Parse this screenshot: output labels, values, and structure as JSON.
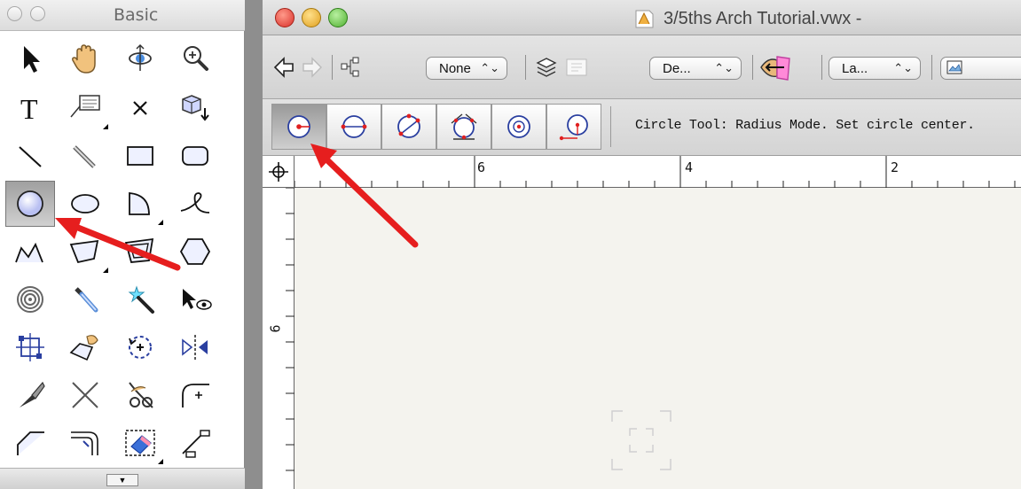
{
  "palette": {
    "title": "Basic",
    "selected_tool": "circle-tool",
    "tools": [
      [
        "selection-tool",
        "pan-tool",
        "flyover-tool",
        "zoom-tool"
      ],
      [
        "text-tool",
        "callout-tool",
        "locus-tool",
        "symbol-insertion-tool"
      ],
      [
        "line-tool",
        "double-line-tool",
        "rectangle-tool",
        "rounded-rectangle-tool"
      ],
      [
        "circle-tool",
        "oval-tool",
        "arc-tool",
        "freehand-tool"
      ],
      [
        "polyline-tool",
        "polygon-tool",
        "double-line-polygon-tool",
        "regular-polygon-tool"
      ],
      [
        "spiral-tool",
        "eyedropper-tool",
        "wand-tool",
        "visibility-tool"
      ],
      [
        "reshape-tool",
        "attribute-mapping-tool",
        "rotate-tool",
        "mirror-tool"
      ],
      [
        "split-tool",
        "trim-tool",
        "clip-tool",
        "fillet-tool"
      ],
      [
        "chamfer-tool",
        "offset-tool",
        "eraser-tool",
        "connect-tool"
      ]
    ]
  },
  "document": {
    "title": "3/5ths Arch Tutorial.vwx -",
    "toolbar": {
      "class_popup": "None",
      "design_layer_popup": "De...",
      "layer_popup": "La..."
    },
    "modes": [
      "radius-mode",
      "diameter-mode",
      "three-point-mode",
      "tangent-mode",
      "center-mode",
      "point-on-circle-mode"
    ],
    "selected_mode": "radius-mode",
    "status": "Circle Tool: Radius Mode. Set circle center.",
    "ruler_top_labels": [
      "6",
      "4",
      "2"
    ],
    "ruler_left_labels": [
      "6"
    ]
  },
  "colors": {
    "annotation_arrow": "#e61e1e",
    "canvas": "#f4f3ee"
  }
}
